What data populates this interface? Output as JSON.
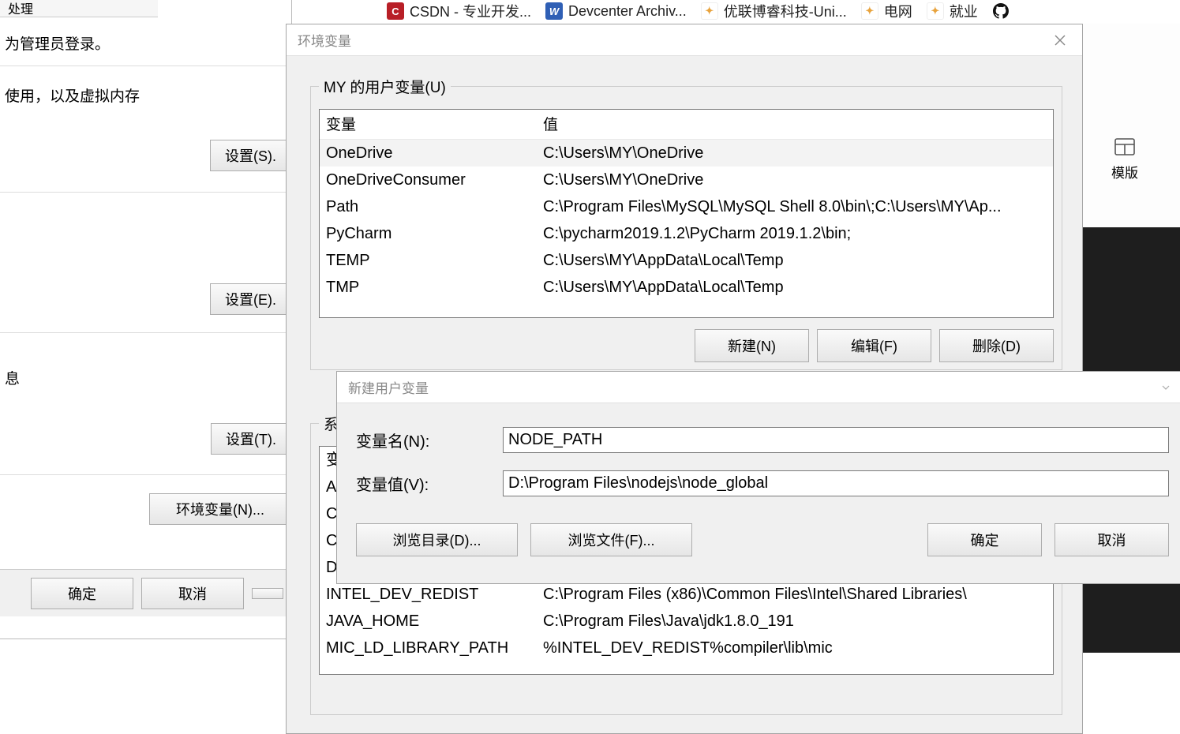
{
  "bookmarks": [
    {
      "label": "CSDN - 专业开发...",
      "icon_bg": "#b81f27",
      "icon_text": "C"
    },
    {
      "label": "Devcenter Archiv...",
      "icon_bg": "#2f5fb5",
      "icon_text": "W"
    },
    {
      "label": "优联博睿科技-Uni...",
      "icon_bg": "#fff",
      "icon_text": "✦"
    },
    {
      "label": "电网",
      "icon_bg": "#fff",
      "icon_text": "✦"
    },
    {
      "label": "就业",
      "icon_bg": "#fff",
      "icon_text": "✦"
    },
    {
      "label": "",
      "icon_bg": "#111",
      "icon_text": "◯"
    }
  ],
  "tabs_partial": "处理",
  "sysprop": {
    "line1": "为管理员登录。",
    "line2": "使用，以及虚拟内存",
    "line3": "息",
    "btn_s": "设置(S).",
    "btn_e": "设置(E).",
    "btn_t": "设置(T).",
    "btn_env": "环境变量(N)...",
    "ok": "确定",
    "cancel": "取消"
  },
  "envvar": {
    "title": "环境变量",
    "group_user": "MY 的用户变量(U)",
    "col_var": "变量",
    "col_val": "值",
    "user_vars": [
      {
        "n": "OneDrive",
        "v": "C:\\Users\\MY\\OneDrive"
      },
      {
        "n": "OneDriveConsumer",
        "v": "C:\\Users\\MY\\OneDrive"
      },
      {
        "n": "Path",
        "v": "C:\\Program Files\\MySQL\\MySQL Shell 8.0\\bin\\;C:\\Users\\MY\\Ap..."
      },
      {
        "n": "PyCharm",
        "v": "C:\\pycharm2019.1.2\\PyCharm 2019.1.2\\bin;"
      },
      {
        "n": "TEMP",
        "v": "C:\\Users\\MY\\AppData\\Local\\Temp"
      },
      {
        "n": "TMP",
        "v": "C:\\Users\\MY\\AppData\\Local\\Temp"
      }
    ],
    "btn_new": "新建(N)",
    "btn_edit": "编辑(F)",
    "btn_del": "删除(D)",
    "group_sys": "系统",
    "sys_vars": [
      {
        "n": "变",
        "v": ""
      },
      {
        "n": "A",
        "v": ""
      },
      {
        "n": "Cl",
        "v": ""
      },
      {
        "n": "Co",
        "v": ""
      },
      {
        "n": "D",
        "v": ""
      },
      {
        "n": "INTEL_DEV_REDIST",
        "v": "C:\\Program Files (x86)\\Common Files\\Intel\\Shared Libraries\\"
      },
      {
        "n": "JAVA_HOME",
        "v": "C:\\Program Files\\Java\\jdk1.8.0_191"
      },
      {
        "n": "MIC_LD_LIBRARY_PATH",
        "v": "%INTEL_DEV_REDIST%compiler\\lib\\mic"
      }
    ]
  },
  "newvar": {
    "title": "新建用户变量",
    "name_label": "变量名(N):",
    "name_value": "NODE_PATH",
    "value_label": "变量值(V):",
    "value_value": "D:\\Program Files\\nodejs\\node_global",
    "browse_dir": "浏览目录(D)...",
    "browse_file": "浏览文件(F)...",
    "ok": "确定",
    "cancel": "取消"
  },
  "right_panel": {
    "template": "模版"
  }
}
